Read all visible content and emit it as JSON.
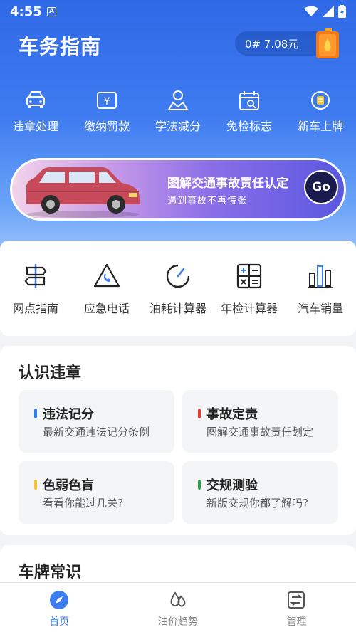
{
  "status_bar": {
    "time": "4:55",
    "notif_icon": "A"
  },
  "header": {
    "title": "车务指南",
    "fuel_price": "0# 7.08元"
  },
  "quick_actions": [
    {
      "label": "违章处理",
      "icon": "car-icon"
    },
    {
      "label": "缴纳罚款",
      "icon": "yen-icon"
    },
    {
      "label": "学法减分",
      "icon": "user-study-icon"
    },
    {
      "label": "免检标志",
      "icon": "calendar-check-icon"
    },
    {
      "label": "新车上牌",
      "icon": "new-plate-icon"
    }
  ],
  "banner": {
    "title": "图解交通事故责任认定",
    "subtitle": "遇到事故不再慌张",
    "button": "Go"
  },
  "tools": [
    {
      "label": "网点指南",
      "icon": "signpost-icon"
    },
    {
      "label": "应急电话",
      "icon": "emergency-phone-icon"
    },
    {
      "label": "油耗计算器",
      "icon": "fuel-gauge-icon"
    },
    {
      "label": "年检计算器",
      "icon": "calculator-icon"
    },
    {
      "label": "汽车销量",
      "icon": "bar-chart-icon"
    }
  ],
  "violations": {
    "title": "认识违章",
    "items": [
      {
        "title": "违法记分",
        "subtitle": "最新交通违法记分条例",
        "color": "#2f7ff0"
      },
      {
        "title": "事故定责",
        "subtitle": "图解交通事故责任划定",
        "color": "#e53935"
      },
      {
        "title": "色弱色盲",
        "subtitle": "看看你能过几关?",
        "color": "#f4c430"
      },
      {
        "title": "交规测验",
        "subtitle": "新版交规你都了解吗?",
        "color": "#2e9e4f"
      }
    ]
  },
  "plates": {
    "title": "车牌常识"
  },
  "tabbar": [
    {
      "label": "首页",
      "icon": "home-compass-icon",
      "active": true
    },
    {
      "label": "油价趋势",
      "icon": "oil-drops-icon",
      "active": false
    },
    {
      "label": "管理",
      "icon": "manage-icon",
      "active": false
    }
  ],
  "colors": {
    "primary": "#3d7df2",
    "hero_top": "#2f69e6",
    "go_button": "#1b1a4c"
  }
}
